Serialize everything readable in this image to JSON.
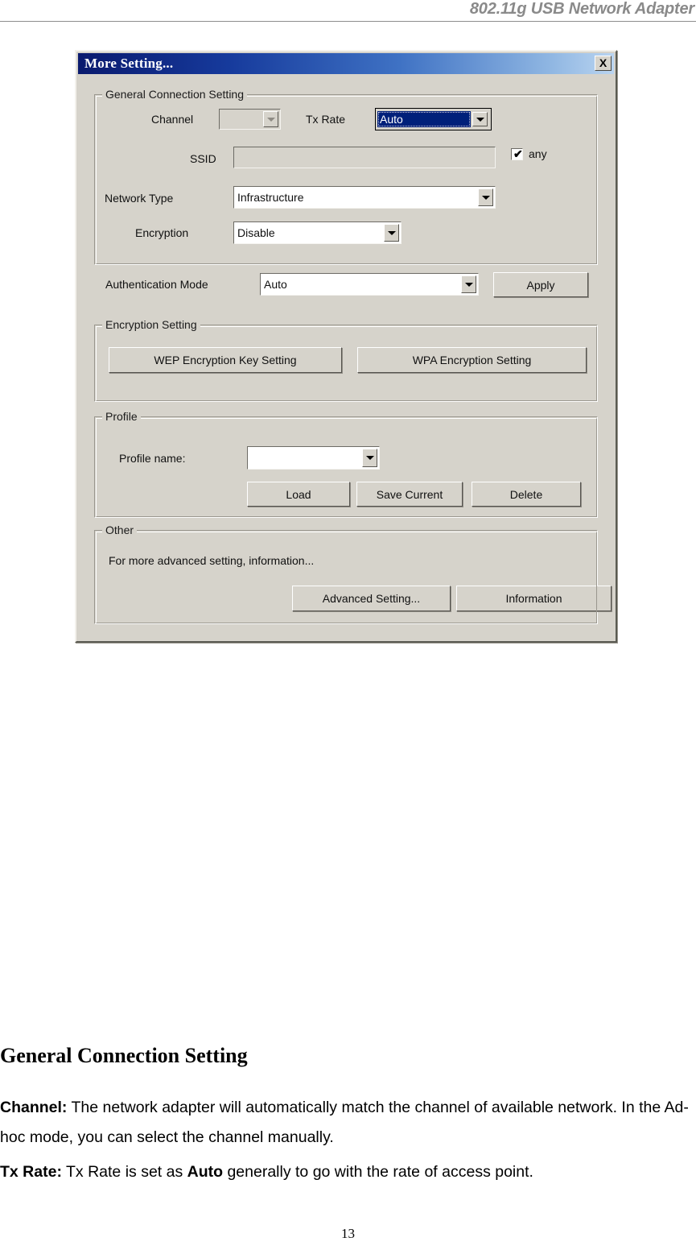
{
  "header": {
    "title": "802.11g USB Network Adapter"
  },
  "dialog": {
    "title": "More Setting...",
    "close_label": "X",
    "general": {
      "group_title": "General Connection Setting",
      "channel_label": "Channel",
      "channel_value": "",
      "tx_rate_label": "Tx Rate",
      "tx_rate_value": "Auto",
      "ssid_label": "SSID",
      "ssid_value": "",
      "any_label": "any",
      "any_checked": "✔",
      "network_type_label": "Network Type",
      "network_type_value": "Infrastructure",
      "encryption_label": "Encryption",
      "encryption_value": "Disable",
      "auth_mode_label": "Authentication Mode",
      "auth_mode_value": "Auto",
      "apply_label": "Apply"
    },
    "encryption_setting": {
      "group_title": "Encryption Setting",
      "wep_button": "WEP Encryption Key Setting",
      "wpa_button": "WPA Encryption Setting"
    },
    "profile": {
      "group_title": "Profile",
      "name_label": "Profile name:",
      "name_value": "",
      "load_button": "Load",
      "save_button": "Save Current",
      "delete_button": "Delete"
    },
    "other": {
      "group_title": "Other",
      "description": "For more advanced setting, information...",
      "advanced_button": "Advanced Setting...",
      "information_button": "Information"
    }
  },
  "document": {
    "heading": "General Connection Setting",
    "para_channel_bold": "Channel:",
    "para_channel_text": " The network adapter will automatically match the channel of available network. In the Ad-hoc mode, you can select the channel manually.",
    "para_txrate_bold": "Tx Rate:",
    "para_txrate_text_1": " Tx Rate is set as ",
    "para_txrate_bold_2": "Auto",
    "para_txrate_text_2": " generally to go with the rate of access point.",
    "page_number": "13"
  },
  "colors": {
    "dialog_background": "#d6d3cb",
    "titlebar_start": "#0a1a6e",
    "titlebar_end": "#b9d4f0",
    "selection_blue": "#00207a",
    "header_gray": "#8a8a8a"
  }
}
